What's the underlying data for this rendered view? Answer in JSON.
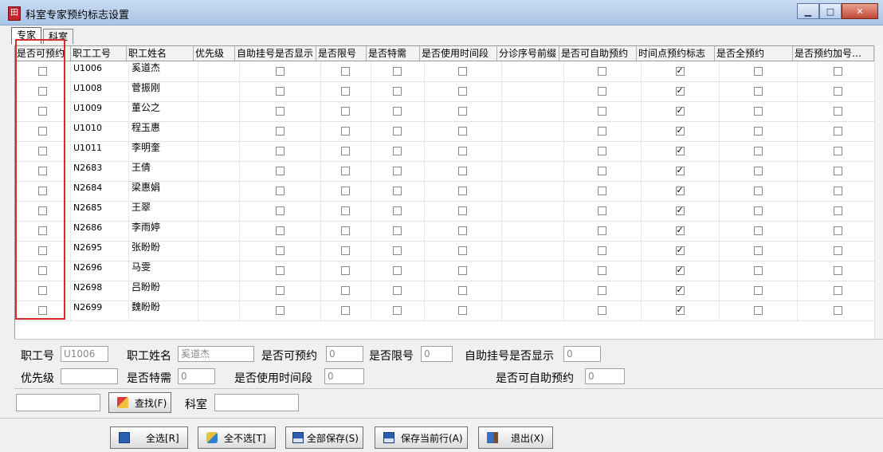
{
  "window": {
    "title": "科室专家预约标志设置",
    "controls": {
      "minimize": "▁",
      "maximize": "□",
      "close": "✕"
    }
  },
  "tabs": [
    {
      "label": "专家",
      "active": true
    },
    {
      "label": "科室",
      "active": false
    }
  ],
  "grid": {
    "columns": [
      "是否可预约",
      "职工工号",
      "职工姓名",
      "优先级",
      "自助挂号是否显示",
      "是否限号",
      "是否特需",
      "是否使用时间段",
      "分诊序号前缀",
      "是否可自助预约",
      "时间点预约标志",
      "是否全预约",
      "是否预约加号…"
    ],
    "rows": [
      {
        "cells": [
          "",
          "U1006",
          "奚道杰",
          "",
          "",
          "",
          "",
          "",
          "",
          "",
          "",
          "",
          ""
        ],
        "time_flag": true
      },
      {
        "cells": [
          "",
          "U1008",
          "菅振刚",
          "",
          "",
          "",
          "",
          "",
          "",
          "",
          "",
          "",
          ""
        ],
        "time_flag": true
      },
      {
        "cells": [
          "",
          "U1009",
          "董公之",
          "",
          "",
          "",
          "",
          "",
          "",
          "",
          "",
          "",
          ""
        ],
        "time_flag": true
      },
      {
        "cells": [
          "",
          "U1010",
          "程玉惠",
          "",
          "",
          "",
          "",
          "",
          "",
          "",
          "",
          "",
          ""
        ],
        "time_flag": true
      },
      {
        "cells": [
          "",
          "U1011",
          "李明奎",
          "",
          "",
          "",
          "",
          "",
          "",
          "",
          "",
          "",
          ""
        ],
        "time_flag": true
      },
      {
        "cells": [
          "",
          "N2683",
          "王倩",
          "",
          "",
          "",
          "",
          "",
          "",
          "",
          "",
          "",
          ""
        ],
        "time_flag": true
      },
      {
        "cells": [
          "",
          "N2684",
          "梁惠娟",
          "",
          "",
          "",
          "",
          "",
          "",
          "",
          "",
          "",
          ""
        ],
        "time_flag": true
      },
      {
        "cells": [
          "",
          "N2685",
          "王翠",
          "",
          "",
          "",
          "",
          "",
          "",
          "",
          "",
          "",
          ""
        ],
        "time_flag": true
      },
      {
        "cells": [
          "",
          "N2686",
          "李雨婷",
          "",
          "",
          "",
          "",
          "",
          "",
          "",
          "",
          "",
          ""
        ],
        "time_flag": true
      },
      {
        "cells": [
          "",
          "N2695",
          "张盼盼",
          "",
          "",
          "",
          "",
          "",
          "",
          "",
          "",
          "",
          ""
        ],
        "time_flag": true
      },
      {
        "cells": [
          "",
          "N2696",
          "马雯",
          "",
          "",
          "",
          "",
          "",
          "",
          "",
          "",
          "",
          ""
        ],
        "time_flag": true
      },
      {
        "cells": [
          "",
          "N2698",
          "吕盼盼",
          "",
          "",
          "",
          "",
          "",
          "",
          "",
          "",
          "",
          ""
        ],
        "time_flag": true
      },
      {
        "cells": [
          "",
          "N2699",
          "魏盼盼",
          "",
          "",
          "",
          "",
          "",
          "",
          "",
          "",
          "",
          ""
        ],
        "time_flag": true
      }
    ]
  },
  "form": {
    "emp_no_label": "职工号",
    "emp_no_value": "U1006",
    "emp_name_label": "职工姓名",
    "emp_name_value": "奚道杰",
    "can_reserve_label": "是否可预约",
    "can_reserve_value": "0",
    "limit_label": "是否限号",
    "limit_value": "0",
    "self_show_label": "自助挂号是否显示",
    "self_show_value": "0",
    "priority_label": "优先级",
    "priority_value": "",
    "special_label": "是否特需",
    "special_value": "0",
    "timeslot_label": "是否使用时间段",
    "timeslot_value": "0",
    "self_reserve_label": "是否可自助预约",
    "self_reserve_value": "0"
  },
  "search": {
    "input_value": "",
    "find_label": "查找(F)",
    "dept_label": "科室",
    "dept_value": ""
  },
  "buttons": {
    "select_all": "全选[R]",
    "select_none": "全不选[T]",
    "save_all": "全部保存(S)",
    "save_row": "保存当前行(A)",
    "exit": "退出(X)"
  },
  "colors": {
    "highlight": "#d92b2b",
    "titlebar": "#b9cfee"
  },
  "icons": {
    "find": "find-icon",
    "select_all": "grid-icon",
    "select_none": "eraser-icon",
    "save": "floppy-icon",
    "exit": "exit-door-icon"
  }
}
